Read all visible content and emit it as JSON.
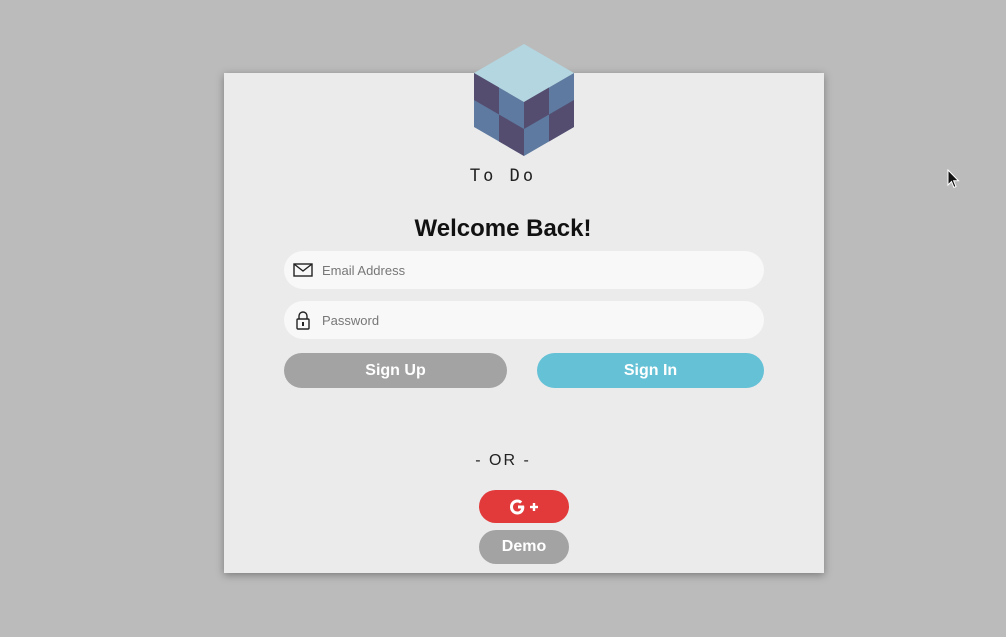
{
  "app": {
    "logo_text": "To Do",
    "logo_icon": "cube-logo-icon"
  },
  "form": {
    "title": "Welcome Back!",
    "email": {
      "placeholder": "Email Address",
      "value": "",
      "icon": "envelope-icon"
    },
    "password": {
      "placeholder": "Password",
      "value": "",
      "icon": "lock-icon"
    },
    "signup_label": "Sign Up",
    "signin_label": "Sign In"
  },
  "alt_login": {
    "divider_text": "- OR -",
    "google_icon": "google-plus-icon",
    "demo_label": "Demo"
  },
  "colors": {
    "background": "#bbbbbb",
    "card": "#ebebeb",
    "signin": "#65c1d6",
    "signup": "#a3a3a3",
    "google": "#e23a3a"
  }
}
